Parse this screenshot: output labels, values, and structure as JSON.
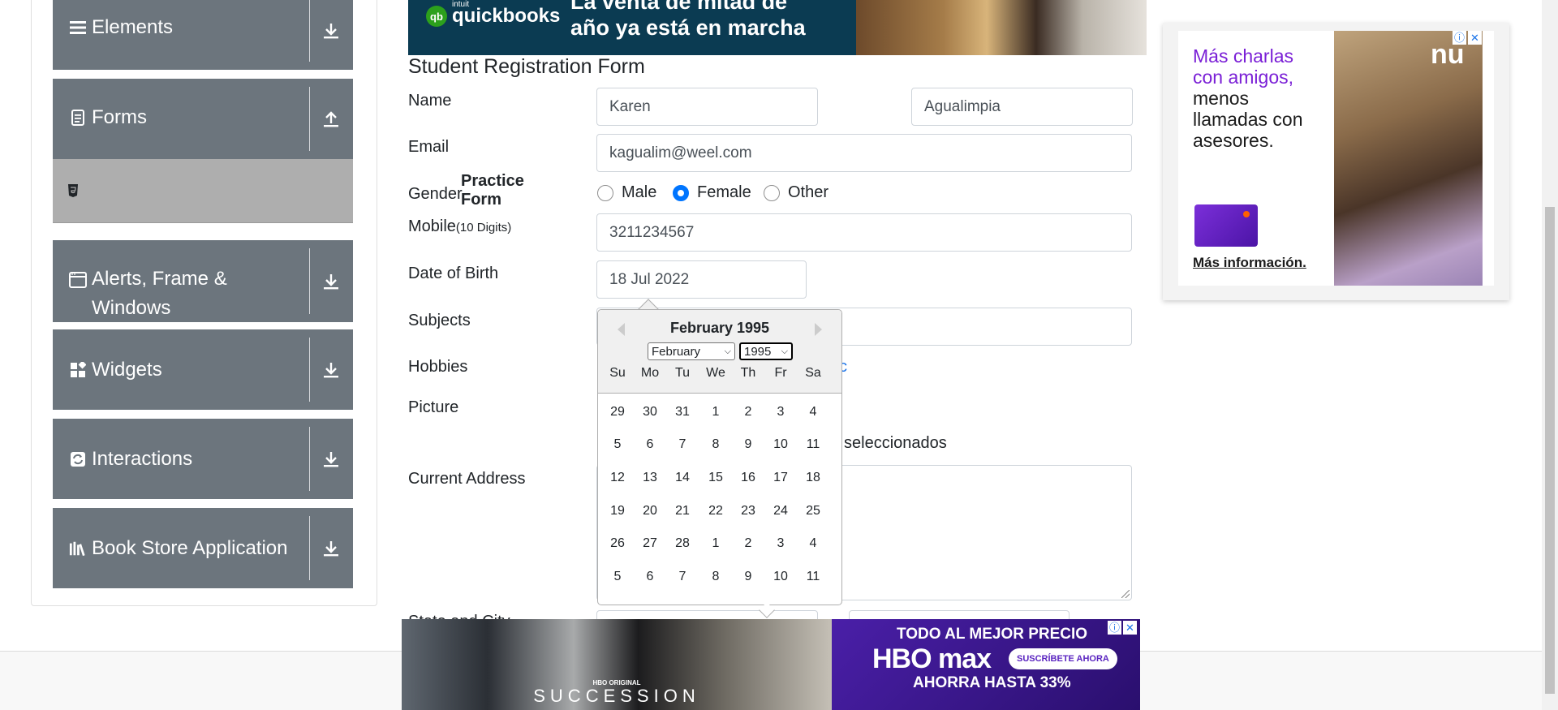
{
  "sidebar": {
    "groups": [
      {
        "label": "Elements",
        "icon": "hamburger-icon",
        "arrow": "download-icon"
      },
      {
        "label": "Forms",
        "icon": "document-icon",
        "arrow": "upload-icon"
      },
      {
        "label": "Alerts, Frame & Windows",
        "icon": "window-icon",
        "arrow": "download-icon"
      },
      {
        "label": "Widgets",
        "icon": "widgets-icon",
        "arrow": "download-icon"
      },
      {
        "label": "Interactions",
        "icon": "interactions-icon",
        "arrow": "download-icon"
      },
      {
        "label": "Book Store Application",
        "icon": "books-icon",
        "arrow": "download-icon"
      }
    ],
    "active_item": {
      "label": "Practice Form",
      "icon": "html5-icon"
    }
  },
  "top_ad": {
    "brand": "quickbooks",
    "brand_prefix": "intuit",
    "line1": "La venta de mitad de",
    "line2": "año ya está en marcha"
  },
  "form": {
    "title": "Student Registration Form",
    "labels": {
      "name": "Name",
      "email": "Email",
      "gender": "Gender",
      "mobile": "Mobile",
      "mobile_hint": "(10 Digits)",
      "dob": "Date of Birth",
      "subjects": "Subjects",
      "hobbies": "Hobbies",
      "picture": "Picture",
      "current_address": "Current Address",
      "state_city": "State and City"
    },
    "first_name": "Karen",
    "last_name": "Agualimpia",
    "email": "kagualim@weel.com",
    "gender_options": [
      "Male",
      "Female",
      "Other"
    ],
    "gender_selected": "Female",
    "mobile": "3211234567",
    "dob": "18 Jul 2022",
    "hobbies_partial": "c",
    "picture_partial": "seleccionados"
  },
  "datepicker": {
    "current_month": "February 1995",
    "month_select": "February",
    "year_select": "1995",
    "day_names": [
      "Su",
      "Mo",
      "Tu",
      "We",
      "Th",
      "Fr",
      "Sa"
    ],
    "weeks": [
      [
        "29",
        "30",
        "31",
        "1",
        "2",
        "3",
        "4"
      ],
      [
        "5",
        "6",
        "7",
        "8",
        "9",
        "10",
        "11"
      ],
      [
        "12",
        "13",
        "14",
        "15",
        "16",
        "17",
        "18"
      ],
      [
        "19",
        "20",
        "21",
        "22",
        "23",
        "24",
        "25"
      ],
      [
        "26",
        "27",
        "28",
        "1",
        "2",
        "3",
        "4"
      ],
      [
        "5",
        "6",
        "7",
        "8",
        "9",
        "10",
        "11"
      ]
    ]
  },
  "right_ad": {
    "headline_purple": "Más charlas con amigos,",
    "headline_dark": "menos llamadas con asesores.",
    "link": "Más información.",
    "brand": "nu"
  },
  "bottom_ad": {
    "show_tag": "HBO ORIGINAL",
    "show": "SUCCESSION",
    "line1": "TODO AL MEJOR PRECIO",
    "brand": "HBO max",
    "cta": "SUSCRÍBETE AHORA",
    "line3": "AHORRA HASTA 33%"
  },
  "colors": {
    "sidebar_bg": "#6c757d",
    "active_item_bg": "#aeaeae",
    "radio_checked": "#0075ff",
    "ad_purple": "#7a1fd6"
  }
}
